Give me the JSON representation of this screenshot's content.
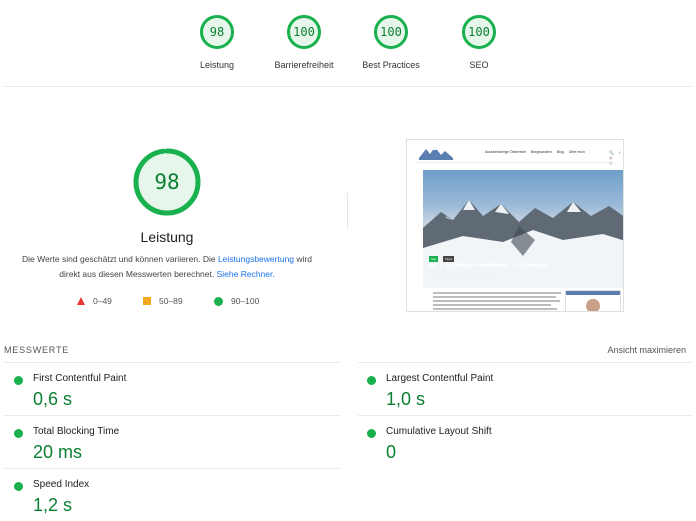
{
  "colors": {
    "pass": "#0c7f33",
    "pass_dot": "#18b14e",
    "average": "#f5a623",
    "fail": "#e53935",
    "ring_bg": "#e6f6ea",
    "link": "#1a73e8"
  },
  "top_gauges": [
    {
      "score": "98",
      "fraction": 0.98,
      "label": "Leistung"
    },
    {
      "score": "100",
      "fraction": 1.0,
      "label": "Barrierefreiheit"
    },
    {
      "score": "100",
      "fraction": 1.0,
      "label": "Best Practices"
    },
    {
      "score": "100",
      "fraction": 1.0,
      "label": "SEO"
    }
  ],
  "performance": {
    "score": "98",
    "fraction": 0.98,
    "title": "Leistung",
    "desc_part1": "Die Werte sind geschätzt und können variieren. Die ",
    "desc_link1": "Leistungsbewertung",
    "desc_part2": " wird direkt aus diesen Messwerten berechnet. ",
    "desc_link2": "Siehe Rechner.",
    "legend": {
      "fail": "0–49",
      "average": "50–89",
      "pass": "90–100"
    }
  },
  "thumbnail": {
    "nav_items": [
      "Aussichtsberge Österreich",
      "Bergwandern",
      "Blog",
      "Über mich"
    ],
    "hero_tag1": "Tag",
    "hero_tag2": "Tipps",
    "hero_title": "Die 5 schönsten Hochtouren in Österreich",
    "hero_meta": "Veröffentlicht von Blogger | Highlights | März 2022",
    "icons": "🔍 f ◎ ◎"
  },
  "metrics": {
    "section_label": "MESSWERTE",
    "expand_link": "Ansicht maximieren",
    "items": [
      {
        "name": "First Contentful Paint",
        "value": "0,6 s"
      },
      {
        "name": "Largest Contentful Paint",
        "value": "1,0 s"
      },
      {
        "name": "Total Blocking Time",
        "value": "20 ms"
      },
      {
        "name": "Cumulative Layout Shift",
        "value": "0"
      },
      {
        "name": "Speed Index",
        "value": "1,2 s"
      }
    ]
  }
}
